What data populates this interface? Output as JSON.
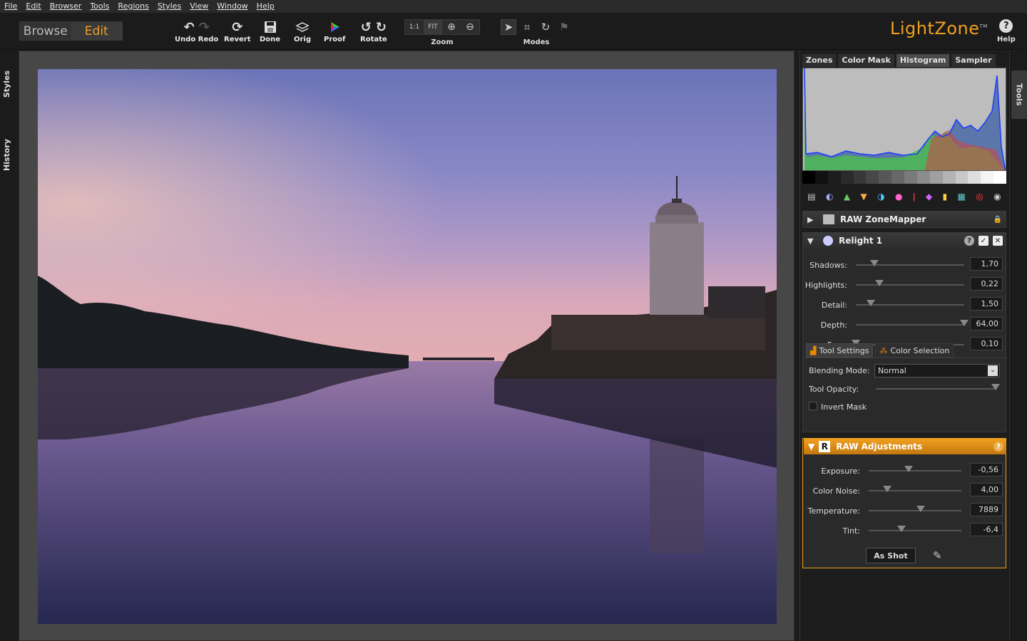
{
  "menu": [
    "File",
    "Edit",
    "Browser",
    "Tools",
    "Regions",
    "Styles",
    "View",
    "Window",
    "Help"
  ],
  "mode_switch": {
    "browse": "Browse",
    "edit": "Edit"
  },
  "toolbar": {
    "undo_redo": "Undo Redo",
    "revert": "Revert",
    "done": "Done",
    "orig": "Orig",
    "proof": "Proof",
    "rotate": "Rotate",
    "zoom_label": "Zoom",
    "zoom_1to1": "1:1",
    "zoom_fit": "FIT",
    "modes_label": "Modes",
    "help": "Help"
  },
  "brand": {
    "name": "LightZone",
    "tm": "TM"
  },
  "left_tabs": [
    "Styles",
    "History"
  ],
  "right_tabs": [
    "Tools"
  ],
  "histogram_tabs": [
    "Zones",
    "Color Mask",
    "Histogram",
    "Sampler"
  ],
  "histogram_active": "Histogram",
  "tools": {
    "zonemapper": {
      "title": "RAW ZoneMapper"
    },
    "relight": {
      "title": "Relight 1",
      "sliders": [
        {
          "label": "Shadows:",
          "value": "1,70",
          "pos": 0.17
        },
        {
          "label": "Highlights:",
          "value": "0,22",
          "pos": 0.22
        },
        {
          "label": "Detail:",
          "value": "1,50",
          "pos": 0.14
        },
        {
          "label": "Depth:",
          "value": "64,00",
          "pos": 1.0
        },
        {
          "label": "Fuzz:",
          "value": "0,10",
          "pos": 0.0
        }
      ],
      "subtabs": [
        "Tool Settings",
        "Color Selection"
      ],
      "blending_label": "Blending Mode:",
      "blending_value": "Normal",
      "opacity_label": "Tool Opacity:",
      "opacity_pos": 1.0,
      "invert_label": "Invert Mask"
    },
    "raw": {
      "title": "RAW Adjustments",
      "sliders": [
        {
          "label": "Exposure:",
          "value": "-0,56",
          "pos": 0.43
        },
        {
          "label": "Color Noise:",
          "value": "4,00",
          "pos": 0.2
        },
        {
          "label": "Temperature:",
          "value": "7889",
          "pos": 0.56
        },
        {
          "label": "Tint:",
          "value": "-6,4",
          "pos": 0.35
        }
      ],
      "as_shot": "As Shot"
    }
  },
  "colors": {
    "accent": "#f0a020"
  }
}
